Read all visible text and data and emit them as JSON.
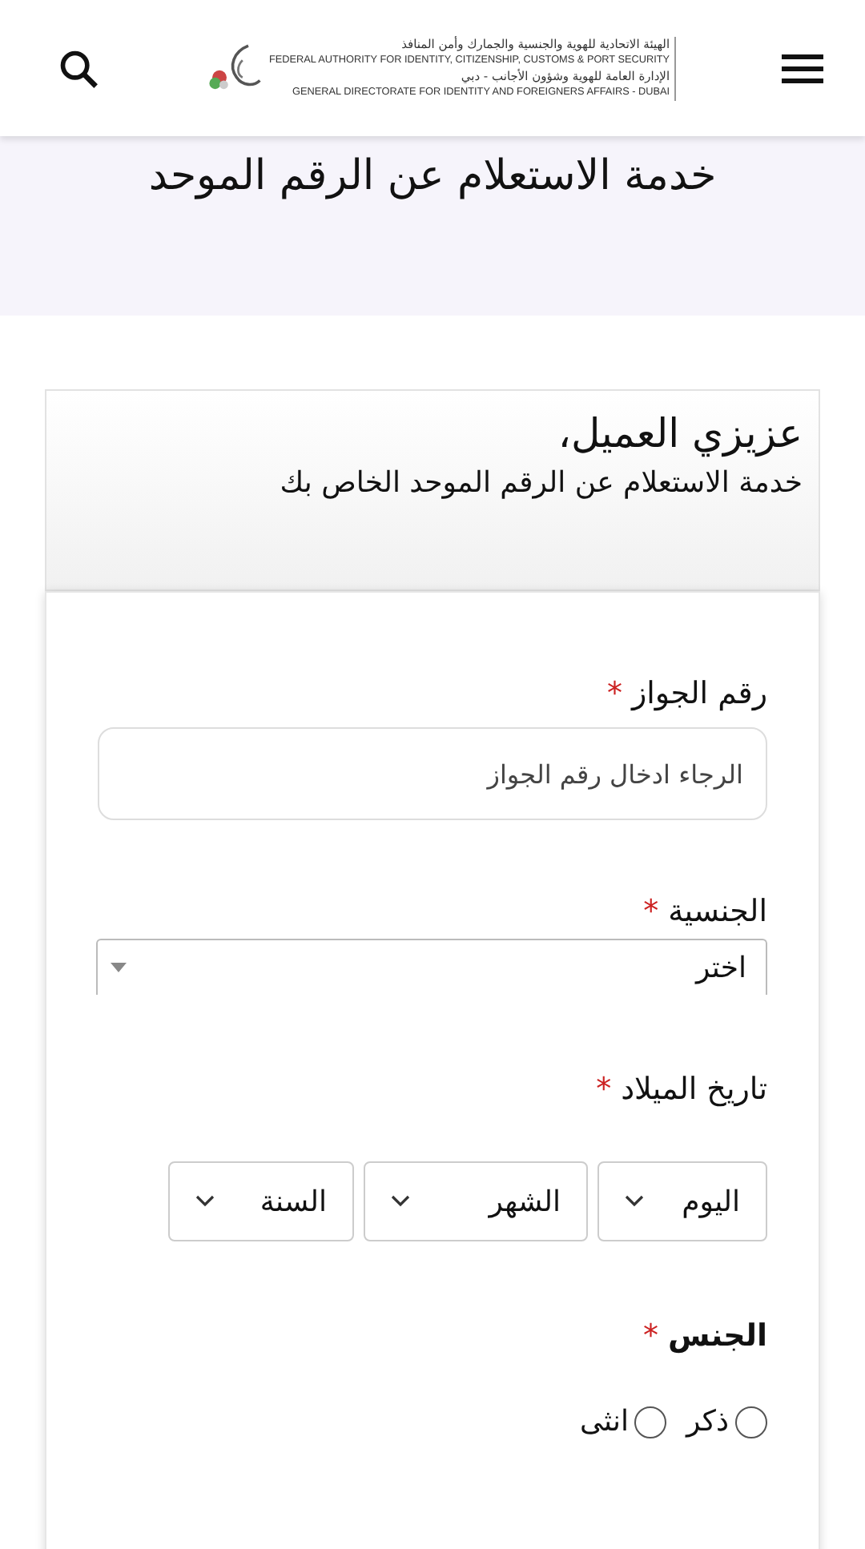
{
  "header": {
    "logo_lines": [
      "الهيئة الاتحادية للهوية والجنسية والجمارك وأمن المنافذ",
      "FEDERAL AUTHORITY FOR IDENTITY, CITIZENSHIP, CUSTOMS & PORT SECURITY",
      "الإدارة العامة للهوية وشؤون الأجانب - دبي",
      "GENERAL DIRECTORATE FOR IDENTITY AND FOREIGNERS AFFAIRS - DUBAI"
    ]
  },
  "page_title": "خدمة الاستعلام عن الرقم الموحد",
  "intro": {
    "greeting": "عزيزي العميل،",
    "text": "خدمة الاستعلام عن الرقم الموحد الخاص بك"
  },
  "fields": [
    {
      "kind": "text",
      "label": "رقم الجواز",
      "asterisk": "*",
      "placeholder": "الرجاء ادخال رقم الجواز"
    },
    {
      "kind": "select",
      "label": "الجنسية",
      "asterisk": "*",
      "value": "اختر"
    },
    {
      "kind": "date",
      "label": "تاريخ الميلاد",
      "asterisk": "*",
      "parts": [
        "اليوم",
        "الشهر",
        "السنة"
      ]
    },
    {
      "kind": "radio",
      "label": "الجنس",
      "asterisk": "*",
      "options": [
        {
          "label": "ذكر",
          "selected": false
        },
        {
          "label": "انثى",
          "selected": false
        }
      ]
    }
  ]
}
